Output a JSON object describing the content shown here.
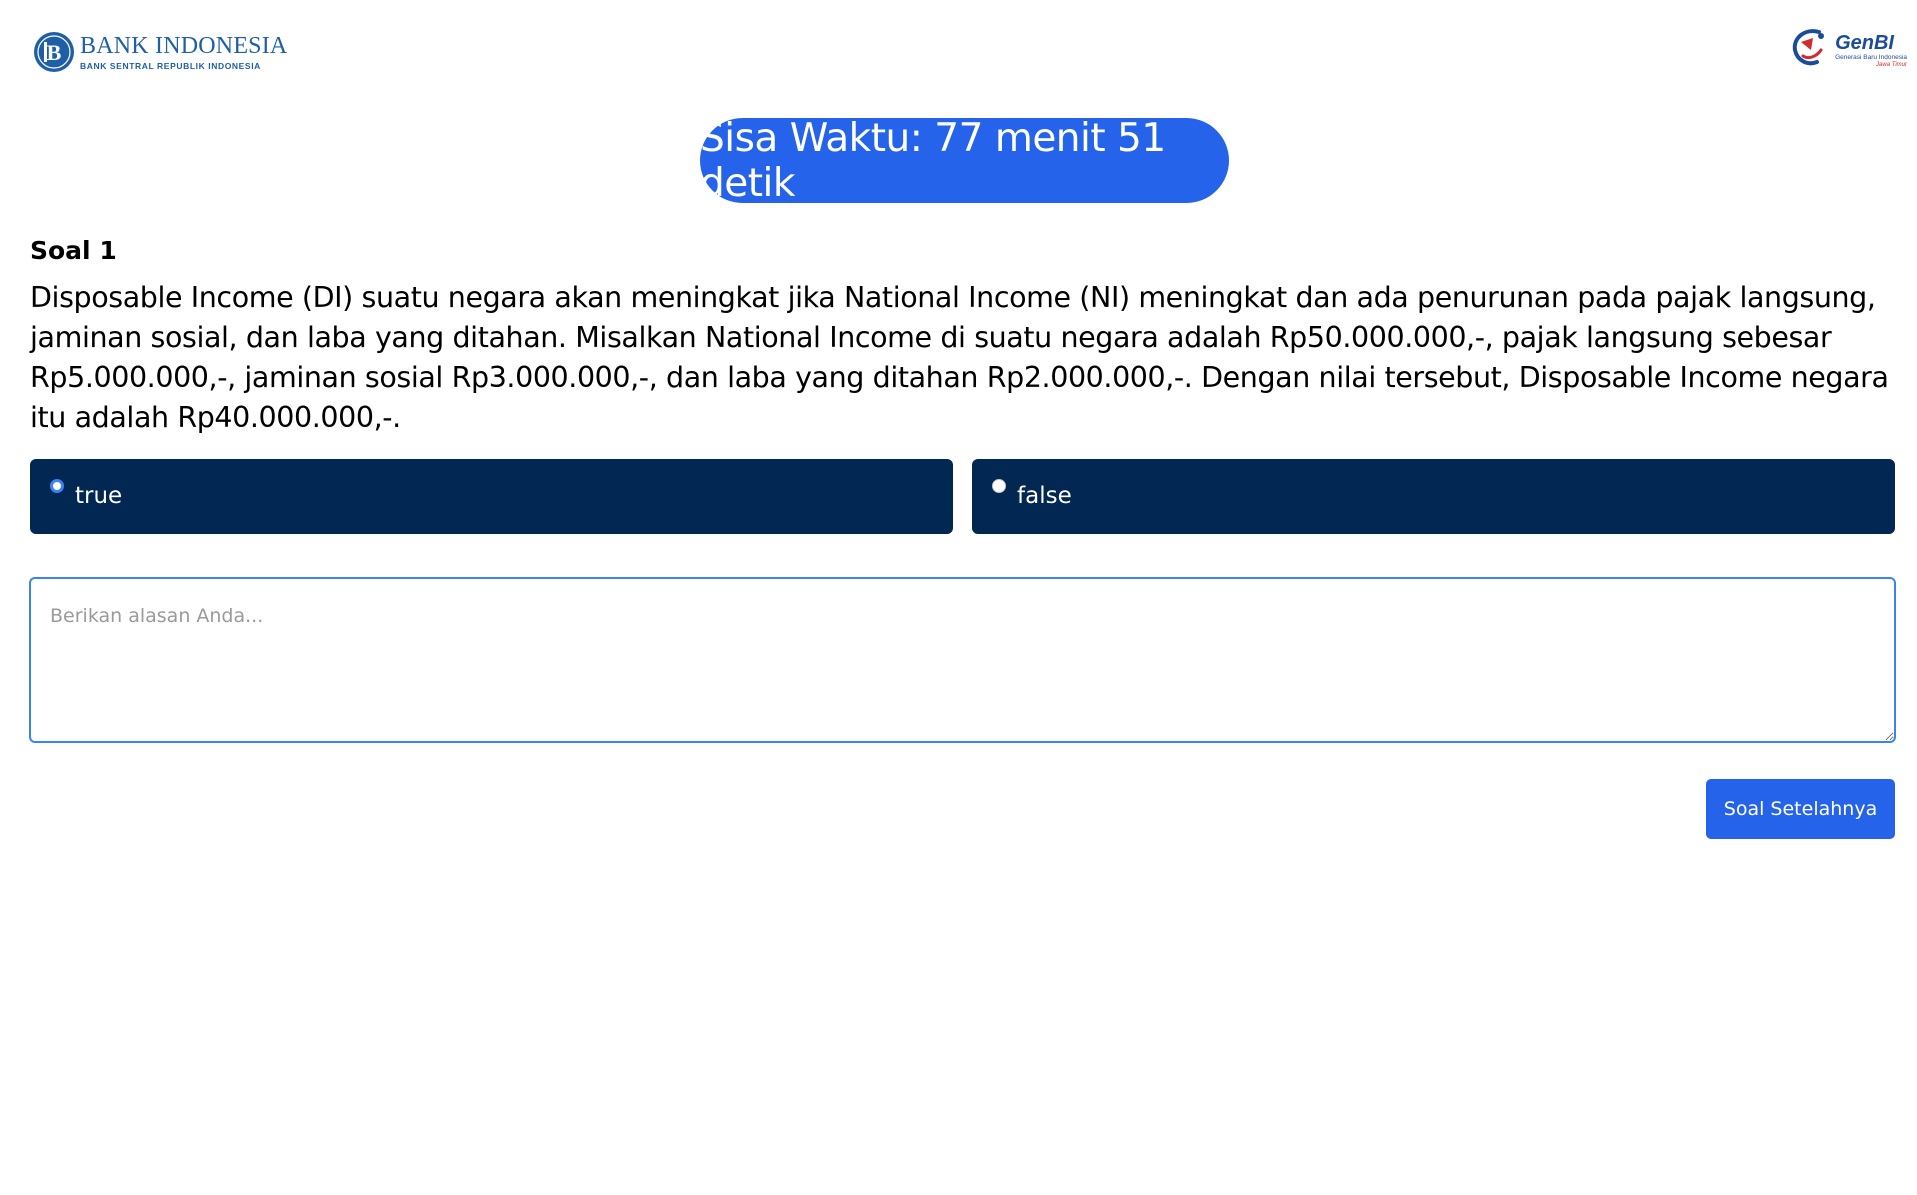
{
  "header": {
    "bi_logo": {
      "name": "BANK INDONESIA",
      "subtitle": "BANK SENTRAL REPUBLIK INDONESIA",
      "icon": "bank-indonesia-emblem-icon"
    },
    "genbi_logo": {
      "name": "GenBI",
      "subtitle": "Generasi Baru Indonesia",
      "region": "Jawa Timur",
      "icon": "genbi-emblem-icon"
    }
  },
  "timer": {
    "text": "Sisa Waktu: 77 menit 51 detik"
  },
  "question": {
    "number_label": "Soal 1",
    "text": "Disposable Income (DI) suatu negara akan meningkat jika National Income (NI) meningkat dan ada penurunan pada pajak langsung, jaminan sosial, dan laba yang ditahan. Misalkan National Income di suatu negara adalah Rp50.000.000,-, pajak langsung sebesar Rp5.000.000,-, jaminan sosial Rp3.000.000,-, dan laba yang ditahan Rp2.000.000,-. Dengan nilai tersebut, Disposable Income negara itu adalah Rp40.000.000,-."
  },
  "options": [
    {
      "label": "true",
      "selected": true
    },
    {
      "label": "false",
      "selected": false
    }
  ],
  "reason": {
    "placeholder": "Berikan alasan Anda...",
    "value": ""
  },
  "navigation": {
    "next_label": "Soal Setelahnya"
  },
  "colors": {
    "accent": "#2563eb",
    "option_bg": "#022753",
    "brand_blue": "#1f5fa8"
  }
}
